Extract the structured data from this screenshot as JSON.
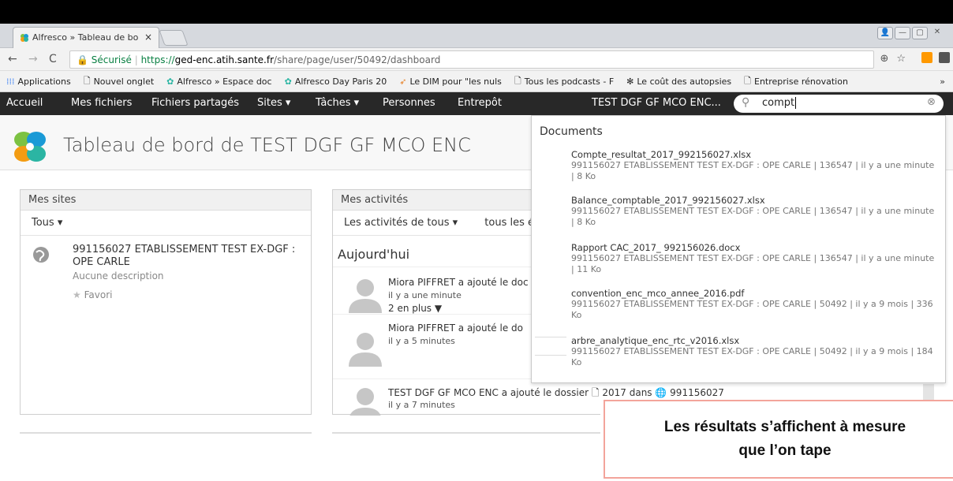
{
  "browser": {
    "tab_title": "Alfresco » Tableau de bo",
    "tab_close": "×",
    "secure_label": "Sécurisé",
    "url_proto": "https://",
    "url_host": "ged-enc.atih.sante.fr",
    "url_path": "/share/page/user/50492/dashboard",
    "bookmarks": [
      {
        "label": "Applications",
        "icon": "apps-grid-icon"
      },
      {
        "label": "Nouvel onglet",
        "icon": "page-icon"
      },
      {
        "label": "Alfresco » Espace doc",
        "icon": "alfresco-icon"
      },
      {
        "label": "Alfresco Day Paris 20",
        "icon": "alfresco-icon"
      },
      {
        "label": "Le DIM pour \"les nuls",
        "icon": "bird-icon"
      },
      {
        "label": "Tous les podcasts - F",
        "icon": "page-icon"
      },
      {
        "label": "Le coût des autopsies",
        "icon": "bug-icon"
      },
      {
        "label": "Entreprise rénovation",
        "icon": "page-icon"
      }
    ],
    "bookmarks_more": "»"
  },
  "nav": {
    "items": [
      "Accueil",
      "Mes fichiers",
      "Fichiers partagés",
      "Sites ▾",
      "Tâches ▾",
      "Personnes",
      "Entrepôt"
    ],
    "user": "TEST DGF GF MCO ENC...",
    "search_value": "compt"
  },
  "page": {
    "title": "Tableau de bord de TEST DGF GF MCO ENC"
  },
  "sites_panel": {
    "title": "Mes sites",
    "filter": "Tous ▾",
    "site_name": "991156027 ETABLISSEMENT TEST EX-DGF : OPE CARLE",
    "site_desc": "Aucune description",
    "favorite": "Favori"
  },
  "activities_panel": {
    "title": "Mes activités",
    "filter1": "Les activités de tous ▾",
    "filter2": "tous les é",
    "day": "Aujourd'hui",
    "items": [
      {
        "text": "Miora PIFFRET a ajouté le doc",
        "time": "il y a une minute",
        "more": "2 en plus ▼"
      },
      {
        "text": "Miora PIFFRET a ajouté le do",
        "time": "il y a 5 minutes"
      },
      {
        "text": "TEST DGF GF MCO ENC a ajouté le dossier",
        "folder": "2017",
        "in": "dans",
        "site": "991156027",
        "time": "il y a 7 minutes"
      }
    ]
  },
  "search_results": {
    "section": "Documents",
    "results": [
      {
        "name": "Compte_resultat_2017_992156027.xlsx",
        "meta": "991156027 ETABLISSEMENT TEST EX-DGF : OPE CARLE | 136547 | il y a une minute | 8 Ko"
      },
      {
        "name": "Balance_comptable_2017_992156027.xlsx",
        "meta": "991156027 ETABLISSEMENT TEST EX-DGF : OPE CARLE | 136547 | il y a une minute | 8 Ko"
      },
      {
        "name": "Rapport CAC_2017_ 992156026.docx",
        "meta": "991156027 ETABLISSEMENT TEST EX-DGF : OPE CARLE | 136547 | il y a une minute | 11 Ko"
      },
      {
        "name": "convention_enc_mco_annee_2016.pdf",
        "meta": "991156027 ETABLISSEMENT TEST EX-DGF : OPE CARLE | 50492 | il y a 9 mois | 336 Ko"
      },
      {
        "name": "arbre_analytique_enc_rtc_v2016.xlsx",
        "meta": "991156027 ETABLISSEMENT TEST EX-DGF : OPE CARLE | 50492 | il y a 9 mois | 184 Ko"
      }
    ]
  },
  "callout": {
    "line1": "Les résultats s’affichent à mesure",
    "line2": "que l’on tape"
  },
  "colors": {
    "accent_green": "#0a8043",
    "nav_bg": "#282828",
    "callout_border": "#f3a49b"
  }
}
